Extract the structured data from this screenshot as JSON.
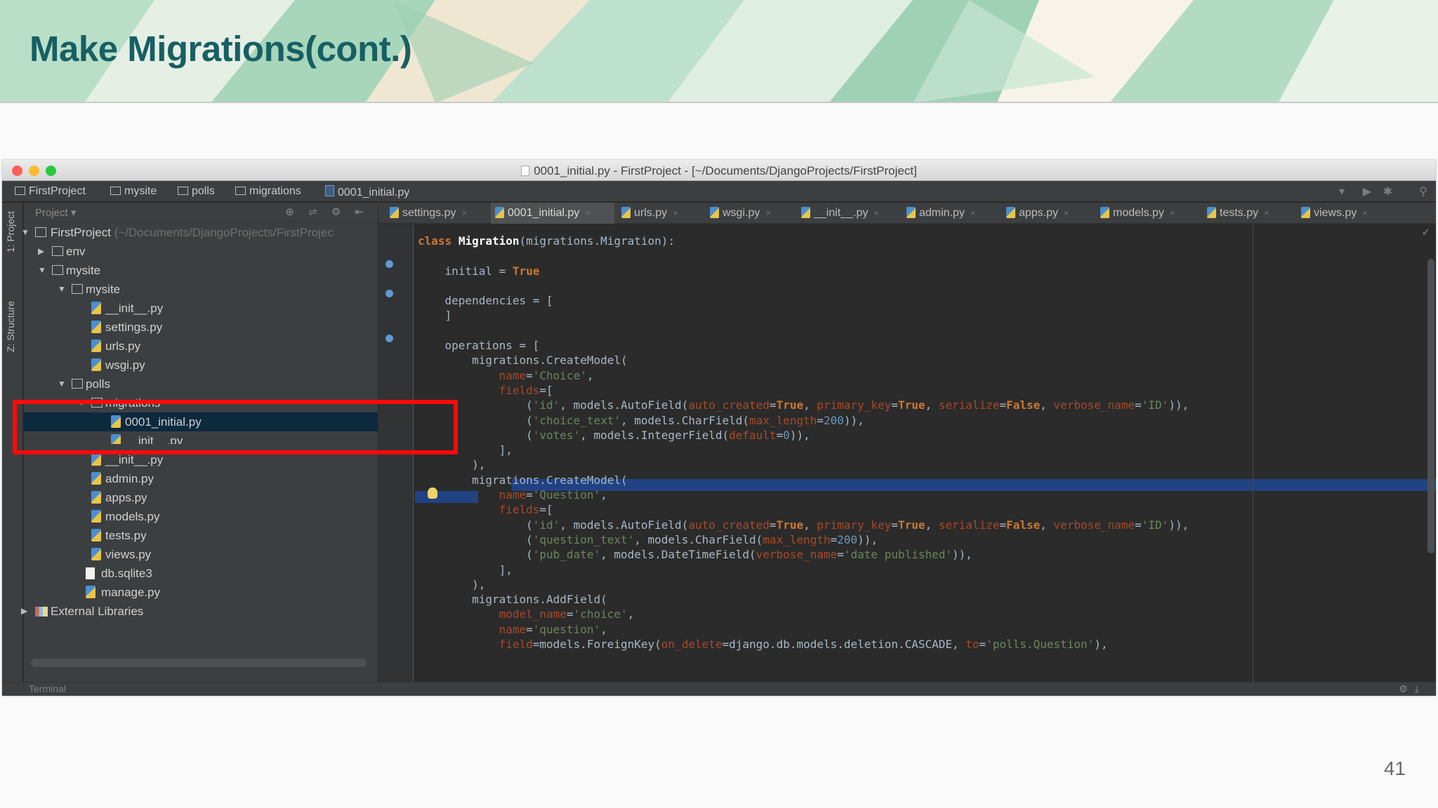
{
  "slide": {
    "title": "Make Migrations(cont.)",
    "page_number": "41"
  },
  "window": {
    "title": "0001_initial.py - FirstProject - [~/Documents/DjangoProjects/FirstProject]"
  },
  "breadcrumbs": [
    "FirstProject",
    "mysite",
    "polls",
    "migrations",
    "0001_initial.py"
  ],
  "tool_strip": {
    "project_tab": "1: Project",
    "structure_tab": "Z: Structure"
  },
  "project_panel": {
    "header": "Project",
    "root_label": "FirstProject",
    "root_path": "(~/Documents/DjangoProjects/FirstProjec",
    "items": [
      {
        "label": "env"
      },
      {
        "label": "mysite"
      },
      {
        "label": "mysite"
      },
      {
        "label": "__init__.py"
      },
      {
        "label": "settings.py"
      },
      {
        "label": "urls.py"
      },
      {
        "label": "wsgi.py"
      },
      {
        "label": "polls"
      },
      {
        "label": "migrations"
      },
      {
        "label": "0001_initial.py"
      },
      {
        "label": "__init__.py"
      },
      {
        "label": "__init__.py"
      },
      {
        "label": "admin.py"
      },
      {
        "label": "apps.py"
      },
      {
        "label": "models.py"
      },
      {
        "label": "tests.py"
      },
      {
        "label": "views.py"
      },
      {
        "label": "db.sqlite3"
      },
      {
        "label": "manage.py"
      },
      {
        "label": "External Libraries"
      }
    ]
  },
  "tabs": [
    {
      "label": "settings.py"
    },
    {
      "label": "0001_initial.py"
    },
    {
      "label": "urls.py"
    },
    {
      "label": "wsgi.py"
    },
    {
      "label": "__init__.py"
    },
    {
      "label": "admin.py"
    },
    {
      "label": "apps.py"
    },
    {
      "label": "models.py"
    },
    {
      "label": "tests.py"
    },
    {
      "label": "views.py"
    }
  ],
  "bottom": {
    "terminal_label": "Terminal"
  },
  "colors": {
    "title": "#175f63",
    "highlight_box": "#ff0a0a",
    "editor_bg": "#2b2b2b",
    "panel_bg": "#3c3f41",
    "selection": "#214283"
  },
  "icons": [
    "folder-icon",
    "python-file-icon",
    "database-file-icon",
    "library-icon",
    "search-icon",
    "run-icon",
    "debug-icon",
    "gear-icon",
    "lightbulb-icon",
    "check-icon"
  ]
}
